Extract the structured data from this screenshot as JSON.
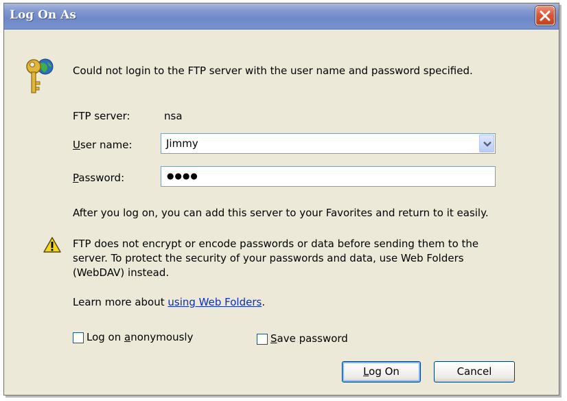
{
  "window": {
    "title": "Log On As",
    "close_icon": "close-icon"
  },
  "message": {
    "icon": "key-globe-icon",
    "text": "Could not login to the FTP server with the user name and password specified."
  },
  "fields": {
    "ftp_server_label": "FTP server:",
    "ftp_server_value": "nsa",
    "user_name_label_mnemonic": "U",
    "user_name_label_rest": "ser name:",
    "user_name_value": "Jimmy",
    "password_label_mnemonic": "P",
    "password_label_rest": "assword:",
    "password_value": "●●●●"
  },
  "info_text": "After you log on, you can add this server to your Favorites and return to it easily.",
  "warning": {
    "icon": "warning-icon",
    "text": "FTP does not encrypt or encode passwords or data before sending them to the server.  To protect the security of your passwords and data, use Web Folders (WebDAV) instead."
  },
  "learn_more": {
    "prefix": "Learn more about ",
    "link": "using Web Folders",
    "suffix": "."
  },
  "options": {
    "anonymous_prefix": "Log on ",
    "anonymous_mnemonic": "a",
    "anonymous_rest": "nonymously",
    "anonymous_checked": false,
    "save_mnemonic": "S",
    "save_rest": "ave password",
    "save_checked": false
  },
  "buttons": {
    "logon_mnemonic": "L",
    "logon_rest": "og On",
    "cancel": "Cancel"
  },
  "colors": {
    "titlebar": "#7a92cf",
    "dialog_bg": "#ece9d8",
    "close_button": "#d9573a",
    "link": "#0b2dbf"
  }
}
